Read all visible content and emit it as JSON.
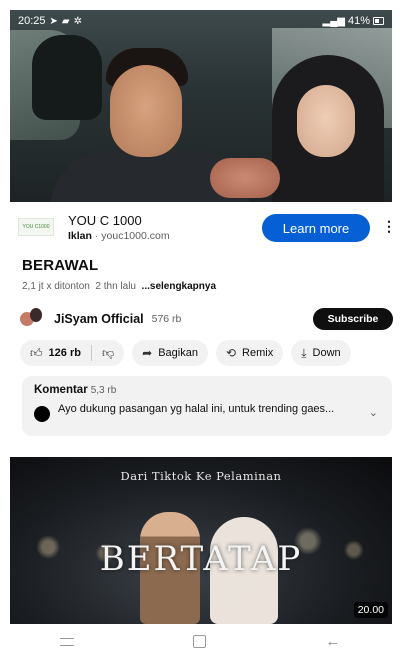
{
  "status_bar": {
    "time": "20:25",
    "battery": "41%"
  },
  "ad": {
    "logo_text": "YOU C1000",
    "title": "YOU C 1000",
    "label": "Iklan",
    "domain": "youc1000.com",
    "cta": "Learn more"
  },
  "video": {
    "title": "BERAWAL",
    "views": "2,1 jt x ditonton",
    "age": "2 thn lalu",
    "more": "...selengkapnya"
  },
  "channel": {
    "name": "JiSyam Official",
    "subscribers": "576 rb",
    "subscribe_label": "Subscribe"
  },
  "actions": {
    "likes": "126 rb",
    "share": "Bagikan",
    "remix": "Remix",
    "download": "Down"
  },
  "comments": {
    "label": "Komentar",
    "count": "5,3 rb",
    "top_comment": "Ayo dukung pasangan yg halal ini, untuk trending gaes..."
  },
  "next_video": {
    "subtitle": "Dari Tiktok Ke Pelaminan",
    "title": "BERTATAP",
    "duration": "20.00"
  },
  "icons": {
    "like": "thumb-up-icon",
    "dislike": "thumb-down-icon",
    "share": "share-icon",
    "remix": "remix-icon",
    "download": "download-icon"
  },
  "colors": {
    "accent": "#065fd4",
    "subscribe_bg": "#0f0f0f",
    "pill_bg": "#f2f2f2"
  }
}
